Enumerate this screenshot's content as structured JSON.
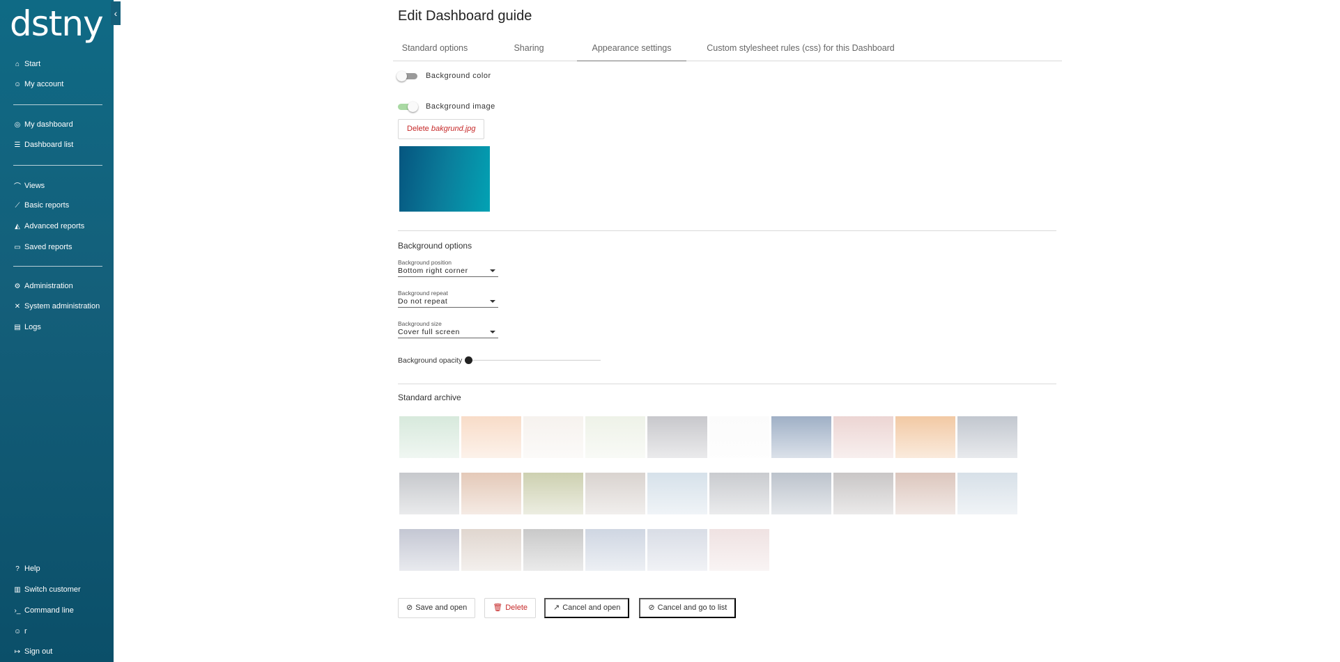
{
  "sidebar": {
    "logo": "dstny",
    "items": [
      {
        "label": "Start",
        "icon": "home-icon"
      },
      {
        "label": "My account",
        "icon": "user-settings-icon"
      },
      {
        "label": "My dashboard",
        "icon": "dashboard-icon"
      },
      {
        "label": "Dashboard list",
        "icon": "list-icon"
      },
      {
        "label": "Views",
        "icon": "views-icon"
      },
      {
        "label": "Basic reports",
        "icon": "line-chart-icon"
      },
      {
        "label": "Advanced reports",
        "icon": "area-chart-icon"
      },
      {
        "label": "Saved reports",
        "icon": "folders-icon"
      },
      {
        "label": "Administration",
        "icon": "gear-icon"
      },
      {
        "label": "System administration",
        "icon": "tools-icon"
      },
      {
        "label": "Logs",
        "icon": "document-icon"
      }
    ],
    "bottom_items": [
      {
        "label": "Help",
        "icon": "help-icon"
      },
      {
        "label": "Switch customer",
        "icon": "building-icon"
      },
      {
        "label": "Command line",
        "icon": "terminal-icon"
      },
      {
        "label": "r",
        "icon": "user-icon"
      },
      {
        "label": "Sign out",
        "icon": "sign-out-icon"
      }
    ]
  },
  "page": {
    "title": "Edit Dashboard guide",
    "tabs": [
      {
        "label": "Standard options",
        "active": false
      },
      {
        "label": "Sharing",
        "active": false
      },
      {
        "label": "Appearance settings",
        "active": true
      },
      {
        "label": "Custom stylesheet rules (css) for this Dashboard",
        "active": false
      }
    ]
  },
  "appearance": {
    "background_color_label": "Background color",
    "background_color_on": false,
    "background_image_label": "Background image",
    "background_image_on": true,
    "delete_prefix": "Delete",
    "delete_filename": "bakgrund.jpg"
  },
  "background_options": {
    "title": "Background options",
    "position": {
      "label": "Background position",
      "value": "Bottom right corner"
    },
    "repeat": {
      "label": "Background repeat",
      "value": "Do not repeat"
    },
    "size": {
      "label": "Background size",
      "value": "Cover full screen"
    },
    "opacity_label": "Background opacity",
    "opacity_value": 0
  },
  "archive": {
    "title": "Standard archive",
    "images": [
      "#d7e9dc",
      "#f8dcc8",
      "#f6f2ee",
      "#eef2e8",
      "#c8c8cc",
      "#fbfbfb",
      "#9fb0c6",
      "#ecd5d3",
      "#f2c9a4",
      "#c2c7cf",
      "#c6c8cc",
      "#e4c9b8",
      "#cdd0b0",
      "#d9d3cf",
      "#d6e1ea",
      "#c9cbcf",
      "#bcc3cc",
      "#c9c6c6",
      "#dcc6bd",
      "#d7e0e8",
      "#c4c7d3",
      "#e0d6cf",
      "#c9c9c9",
      "#cfd6e2",
      "#d9dde6",
      "#efe2e2"
    ]
  },
  "actions": {
    "save": "Save and open",
    "delete": "Delete",
    "cancel_open": "Cancel and open",
    "cancel_list": "Cancel and go to list"
  },
  "colors": {
    "sidebar": "#145f7a",
    "accent_red": "#c62828",
    "toggle_on": "#a9d9a3",
    "logo_dot": "#f2a33a"
  }
}
